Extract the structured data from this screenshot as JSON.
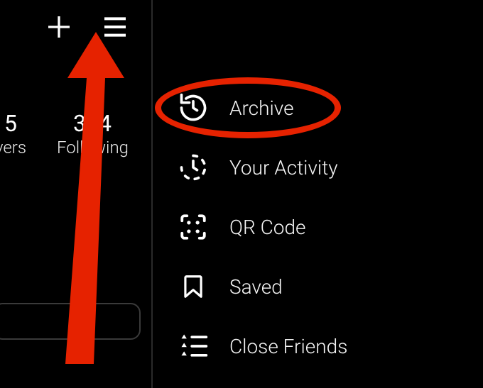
{
  "annotation_color": "#e62200",
  "topbar": {
    "plus_label": "Create",
    "menu_label": "Menu"
  },
  "stats": {
    "posts": {
      "value": "5",
      "label": "vers"
    },
    "following": {
      "value": "374",
      "label": "Following"
    }
  },
  "menu": {
    "items": [
      {
        "label": "Archive",
        "icon": "archive"
      },
      {
        "label": "Your Activity",
        "icon": "activity"
      },
      {
        "label": "QR Code",
        "icon": "qrcode"
      },
      {
        "label": "Saved",
        "icon": "saved"
      },
      {
        "label": "Close Friends",
        "icon": "closefriends"
      }
    ]
  }
}
